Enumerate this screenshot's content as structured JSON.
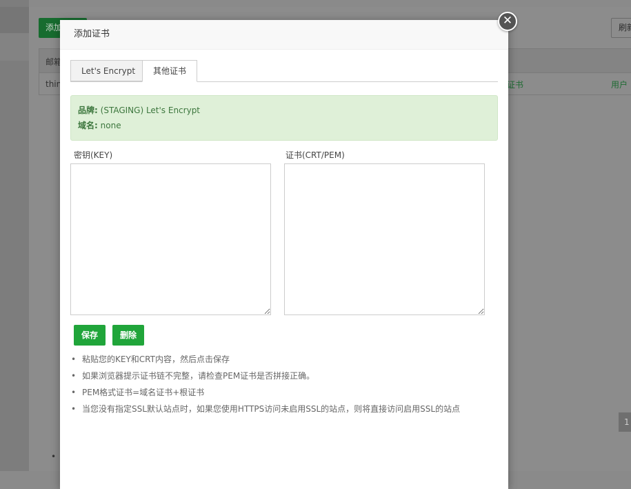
{
  "background": {
    "add_button": "添加",
    "refresh_button": "刷新",
    "table_header": "邮箱",
    "table_row_value": "thin",
    "link_cert": "证书",
    "link_user": "用户",
    "page_number": "1",
    "bullet": "•"
  },
  "modal": {
    "title": "添加证书",
    "close_symbol": "✕",
    "tabs": [
      {
        "label": "Let's Encrypt",
        "active": false
      },
      {
        "label": "其他证书",
        "active": true
      }
    ],
    "info": {
      "brand_label": "品牌:",
      "brand_value": "(STAGING) Let's Encrypt",
      "domain_label": "域名:",
      "domain_value": "none"
    },
    "key_label": "密钥(KEY)",
    "key_value": "",
    "crt_label": "证书(CRT/PEM)",
    "crt_value": "",
    "save_button": "保存",
    "delete_button": "删除",
    "tips": [
      "粘贴您的KEY和CRT内容，然后点击保存",
      "如果浏览器提示证书链不完整，请检查PEM证书是否拼接正确。",
      "PEM格式证书=域名证书+根证书",
      "当您没有指定SSL默认站点时，如果您使用HTTPS访问未启用SSL的站点，则将直接访问启用SSL的站点"
    ],
    "tip_bullet": "•"
  },
  "colors": {
    "primary_green": "#20a53a",
    "info_bg": "#dff0d8",
    "info_text": "#3c763d",
    "overlay": "#8a8a8a"
  }
}
